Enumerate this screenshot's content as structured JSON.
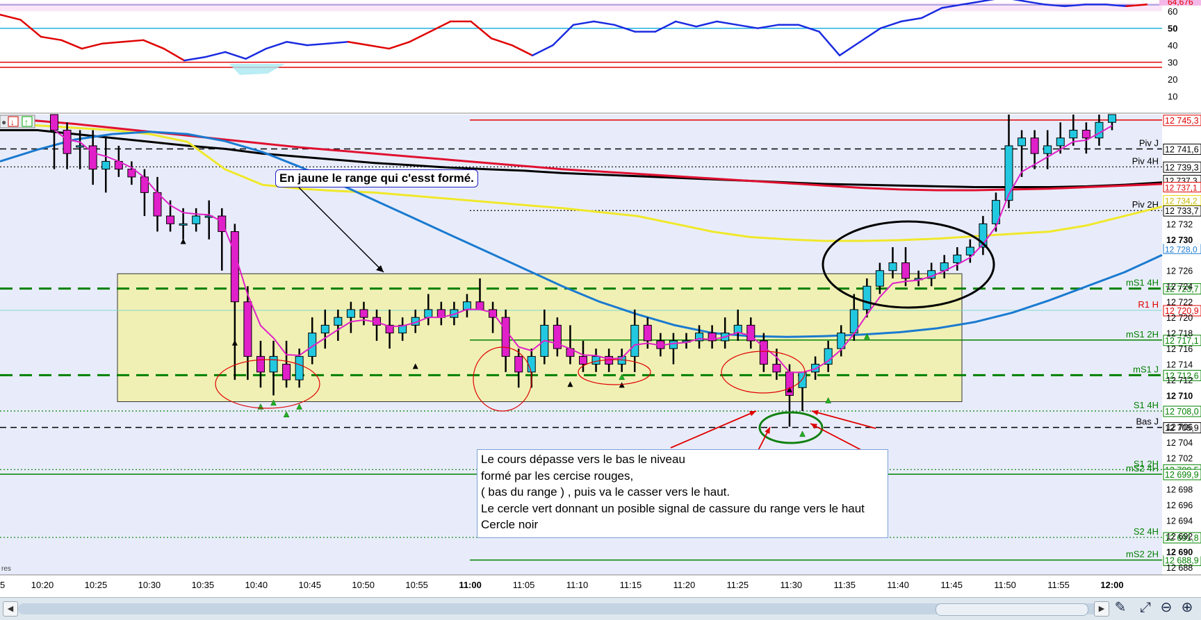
{
  "chart_data": [
    {
      "type": "line",
      "panel": "RSI indicator",
      "yticks": [
        "60",
        "50",
        "40",
        "30",
        "20",
        "10"
      ],
      "current_value_label": "64,676",
      "levels": [
        50,
        30,
        27
      ],
      "series": [
        {
          "color": "#e00000",
          "values": [
            58,
            55,
            45,
            43,
            38,
            41,
            42,
            43,
            38,
            31,
            33,
            36,
            32,
            38,
            42,
            40,
            41,
            42,
            40,
            38,
            42,
            48,
            54,
            54,
            44,
            40,
            34,
            40,
            52,
            54,
            52,
            48,
            48,
            54,
            51,
            54,
            52,
            50,
            52,
            52,
            48,
            34,
            42,
            50,
            54,
            56,
            62,
            64,
            66,
            68,
            66,
            64,
            63,
            64,
            64,
            63,
            64
          ]
        },
        {
          "color": "#1a2be0",
          "values": [
            null,
            null,
            null,
            null,
            null,
            null,
            null,
            null,
            null,
            null,
            null,
            null,
            null,
            null,
            null,
            null,
            null,
            null,
            null,
            null,
            null,
            null,
            null,
            null,
            null,
            null,
            null,
            null,
            null,
            null,
            null,
            null,
            null,
            null,
            null,
            null,
            null,
            null,
            null,
            null,
            null,
            null,
            null,
            null,
            null,
            null,
            null,
            null,
            null,
            null,
            null,
            null,
            null,
            null,
            null,
            null,
            null
          ]
        }
      ],
      "ylim": [
        0,
        65
      ]
    },
    {
      "type": "candlestick",
      "panel": "price",
      "x_ticks": [
        "10:20",
        "10:25",
        "10:30",
        "10:35",
        "10:40",
        "10:45",
        "10:50",
        "10:55",
        "11:00",
        "11:05",
        "11:10",
        "11:15",
        "11:20",
        "11:25",
        "11:30",
        "11:35",
        "11:40",
        "11:45",
        "11:50",
        "11:55",
        "12:00"
      ],
      "x_tick_first": "5",
      "x_axis_suffix": "res",
      "ylim": [
        12687,
        12746
      ],
      "price_ticks": [
        "12 732",
        "12 730",
        "12 726",
        "12 724",
        "12 722",
        "12 720",
        "12 718",
        "12 716",
        "12 714",
        "12 712",
        "12 710",
        "12 706",
        "12 704",
        "12 702",
        "12 698",
        "12 696",
        "12 694",
        "12 692",
        "12 690",
        "12 688"
      ],
      "bold_ticks": [
        "12 730",
        "12 710",
        "12 690"
      ],
      "levels": [
        {
          "label": "",
          "value_label": "12 745,3",
          "price": 12745.3,
          "color": "#e00000",
          "style": "solid"
        },
        {
          "label": "Piv J",
          "value_label": "12 741,6",
          "price": 12741.6,
          "color": "#000000",
          "style": "dash"
        },
        {
          "label": "Piv 4H",
          "value_label": "12 739,3",
          "price": 12739.3,
          "color": "#000000",
          "style": "dot"
        },
        {
          "label": "Piv 2H",
          "value_label": "12 733,7",
          "price": 12733.7,
          "color": "#000000",
          "style": "dot"
        },
        {
          "label": "mS1 4H",
          "value_label": "12 723,7",
          "price": 12723.7,
          "color": "#008000",
          "style": "bigdash"
        },
        {
          "label": "R1 H",
          "value_label": "12 720,9",
          "price": 12720.9,
          "color": "#e00000",
          "style": "thin"
        },
        {
          "label": "mS1 2H",
          "value_label": "12 717,1",
          "price": 12717.1,
          "color": "#008000",
          "style": "solid"
        },
        {
          "label": "mS1 J",
          "value_label": "12 712,6",
          "price": 12712.6,
          "color": "#008000",
          "style": "bigdash"
        },
        {
          "label": "S1 4H",
          "value_label": "12 708,0",
          "price": 12708.0,
          "color": "#008000",
          "style": "dot"
        },
        {
          "label": "Bas J",
          "value_label": "12 705,9",
          "price": 12705.9,
          "color": "#000000",
          "style": "dash"
        },
        {
          "label": "S1 2H",
          "value_label": "12 700,5",
          "price": 12700.5,
          "color": "#008000",
          "style": "dot"
        },
        {
          "label": "mS2 4H",
          "value_label": "12 699,9",
          "price": 12699.9,
          "color": "#008000",
          "style": "solid"
        },
        {
          "label": "S2 4H",
          "value_label": "12 691,8",
          "price": 12691.8,
          "color": "#008000",
          "style": "dot"
        },
        {
          "label": "mS2 2H",
          "value_label": "12 688,9",
          "price": 12688.9,
          "color": "#008000",
          "style": "solid"
        }
      ],
      "extra_axis_labels": [
        {
          "text": "12 737,3",
          "price": 12737.6,
          "color": "#000000"
        },
        {
          "text": "12 737,1",
          "price": 12736.7,
          "color": "#e00000"
        },
        {
          "text": "12 734,2",
          "price": 12735.0,
          "color": "#e8d800"
        },
        {
          "text": "12 728,0",
          "price": 12728.8,
          "color": "#1a7ad0"
        }
      ],
      "candles": [
        {
          "o": 12746,
          "h": 12746,
          "l": 12739,
          "c": 12744
        },
        {
          "o": 12744,
          "h": 12745,
          "l": 12739,
          "c": 12741
        },
        {
          "o": 12742,
          "h": 12744,
          "l": 12739,
          "c": 12742
        },
        {
          "o": 12742,
          "h": 12744,
          "l": 12737,
          "c": 12739
        },
        {
          "o": 12739,
          "h": 12743,
          "l": 12736,
          "c": 12740
        },
        {
          "o": 12740,
          "h": 12742,
          "l": 12738,
          "c": 12739
        },
        {
          "o": 12739,
          "h": 12740,
          "l": 12737,
          "c": 12738
        },
        {
          "o": 12738,
          "h": 12739,
          "l": 12733,
          "c": 12736
        },
        {
          "o": 12736,
          "h": 12738,
          "l": 12731,
          "c": 12733
        },
        {
          "o": 12733,
          "h": 12735,
          "l": 12731,
          "c": 12732
        },
        {
          "o": 12732,
          "h": 12734,
          "l": 12730,
          "c": 12732
        },
        {
          "o": 12732,
          "h": 12734,
          "l": 12731,
          "c": 12733
        },
        {
          "o": 12733,
          "h": 12735,
          "l": 12730,
          "c": 12733
        },
        {
          "o": 12733,
          "h": 12734,
          "l": 12726,
          "c": 12731
        },
        {
          "o": 12731,
          "h": 12732,
          "l": 12712,
          "c": 12722
        },
        {
          "o": 12722,
          "h": 12724,
          "l": 12712,
          "c": 12715
        },
        {
          "o": 12715,
          "h": 12717,
          "l": 12711,
          "c": 12713
        },
        {
          "o": 12713,
          "h": 12717,
          "l": 12710,
          "c": 12715
        },
        {
          "o": 12714,
          "h": 12717,
          "l": 12711,
          "c": 12712
        },
        {
          "o": 12712,
          "h": 12716,
          "l": 12711,
          "c": 12715
        },
        {
          "o": 12715,
          "h": 12720,
          "l": 12714,
          "c": 12718
        },
        {
          "o": 12718,
          "h": 12721,
          "l": 12716,
          "c": 12719
        },
        {
          "o": 12719,
          "h": 12721,
          "l": 12717,
          "c": 12720
        },
        {
          "o": 12720,
          "h": 12722,
          "l": 12718,
          "c": 12721
        },
        {
          "o": 12721,
          "h": 12722,
          "l": 12719,
          "c": 12720
        },
        {
          "o": 12720,
          "h": 12721,
          "l": 12717,
          "c": 12719
        },
        {
          "o": 12719,
          "h": 12721,
          "l": 12716,
          "c": 12718
        },
        {
          "o": 12718,
          "h": 12720,
          "l": 12717,
          "c": 12719
        },
        {
          "o": 12719,
          "h": 12721,
          "l": 12718,
          "c": 12720
        },
        {
          "o": 12720,
          "h": 12723,
          "l": 12719,
          "c": 12721
        },
        {
          "o": 12721,
          "h": 12722,
          "l": 12719,
          "c": 12720
        },
        {
          "o": 12720,
          "h": 12722,
          "l": 12719,
          "c": 12721
        },
        {
          "o": 12721,
          "h": 12723,
          "l": 12720,
          "c": 12722
        },
        {
          "o": 12722,
          "h": 12725,
          "l": 12721,
          "c": 12721
        },
        {
          "o": 12721,
          "h": 12722,
          "l": 12718,
          "c": 12720
        },
        {
          "o": 12720,
          "h": 12721,
          "l": 12713,
          "c": 12715
        },
        {
          "o": 12715,
          "h": 12716,
          "l": 12711,
          "c": 12713
        },
        {
          "o": 12713,
          "h": 12716,
          "l": 12711,
          "c": 12715
        },
        {
          "o": 12715,
          "h": 12721,
          "l": 12714,
          "c": 12719
        },
        {
          "o": 12719,
          "h": 12720,
          "l": 12715,
          "c": 12716
        },
        {
          "o": 12716,
          "h": 12719,
          "l": 12714,
          "c": 12715
        },
        {
          "o": 12715,
          "h": 12717,
          "l": 12713,
          "c": 12714
        },
        {
          "o": 12714,
          "h": 12716,
          "l": 12713,
          "c": 12715
        },
        {
          "o": 12715,
          "h": 12716,
          "l": 12713,
          "c": 12714
        },
        {
          "o": 12714,
          "h": 12716,
          "l": 12713,
          "c": 12715
        },
        {
          "o": 12715,
          "h": 12721,
          "l": 12713,
          "c": 12719
        },
        {
          "o": 12719,
          "h": 12720,
          "l": 12716,
          "c": 12717
        },
        {
          "o": 12717,
          "h": 12718,
          "l": 12715,
          "c": 12716
        },
        {
          "o": 12716,
          "h": 12718,
          "l": 12714,
          "c": 12717
        },
        {
          "o": 12717,
          "h": 12718,
          "l": 12716,
          "c": 12717
        },
        {
          "o": 12717,
          "h": 12719,
          "l": 12716,
          "c": 12718
        },
        {
          "o": 12718,
          "h": 12719,
          "l": 12716,
          "c": 12717
        },
        {
          "o": 12717,
          "h": 12720,
          "l": 12716,
          "c": 12718
        },
        {
          "o": 12718,
          "h": 12721,
          "l": 12717,
          "c": 12719
        },
        {
          "o": 12719,
          "h": 12720,
          "l": 12716,
          "c": 12717
        },
        {
          "o": 12717,
          "h": 12718,
          "l": 12713,
          "c": 12714
        },
        {
          "o": 12714,
          "h": 12716,
          "l": 12712,
          "c": 12713
        },
        {
          "o": 12713,
          "h": 12714,
          "l": 12706,
          "c": 12710
        },
        {
          "o": 12711,
          "h": 12713,
          "l": 12708,
          "c": 12713
        },
        {
          "o": 12713,
          "h": 12715,
          "l": 12712,
          "c": 12714
        },
        {
          "o": 12714,
          "h": 12717,
          "l": 12713,
          "c": 12716
        },
        {
          "o": 12716,
          "h": 12719,
          "l": 12715,
          "c": 12718
        },
        {
          "o": 12718,
          "h": 12723,
          "l": 12717,
          "c": 12721
        },
        {
          "o": 12721,
          "h": 12725,
          "l": 12720,
          "c": 12724
        },
        {
          "o": 12724,
          "h": 12727,
          "l": 12723,
          "c": 12726
        },
        {
          "o": 12726,
          "h": 12729,
          "l": 12725,
          "c": 12727
        },
        {
          "o": 12727,
          "h": 12729,
          "l": 12724,
          "c": 12725
        },
        {
          "o": 12725,
          "h": 12726,
          "l": 12724,
          "c": 12725
        },
        {
          "o": 12725,
          "h": 12727,
          "l": 12724,
          "c": 12726
        },
        {
          "o": 12726,
          "h": 12728,
          "l": 12725,
          "c": 12727
        },
        {
          "o": 12727,
          "h": 12729,
          "l": 12726,
          "c": 12728
        },
        {
          "o": 12728,
          "h": 12730,
          "l": 12727,
          "c": 12729
        },
        {
          "o": 12729,
          "h": 12733,
          "l": 12728,
          "c": 12732
        },
        {
          "o": 12732,
          "h": 12736,
          "l": 12731,
          "c": 12735
        },
        {
          "o": 12735,
          "h": 12746,
          "l": 12734,
          "c": 12742
        },
        {
          "o": 12742,
          "h": 12744,
          "l": 12738,
          "c": 12743
        },
        {
          "o": 12743,
          "h": 12744,
          "l": 12739,
          "c": 12741
        },
        {
          "o": 12741,
          "h": 12744,
          "l": 12739,
          "c": 12742
        },
        {
          "o": 12742,
          "h": 12745,
          "l": 12741,
          "c": 12743
        },
        {
          "o": 12743,
          "h": 12746,
          "l": 12742,
          "c": 12744
        },
        {
          "o": 12744,
          "h": 12745,
          "l": 12741,
          "c": 12743
        },
        {
          "o": 12743,
          "h": 12746,
          "l": 12742,
          "c": 12745
        },
        {
          "o": 12745,
          "h": 12746,
          "l": 12744,
          "c": 12746
        }
      ],
      "moving_averages": [
        {
          "color": "#000000",
          "values": [
            12744,
            12744,
            12743.5,
            12743,
            12742.5,
            12742,
            12741.6,
            12741,
            12740.6,
            12740.2,
            12739.8,
            12739.5,
            12739.2,
            12739,
            12738.8,
            12738.5,
            12738.3,
            12738.1,
            12737.9,
            12737.7,
            12737.5,
            12737.3,
            12737.1,
            12737,
            12736.9,
            12736.8,
            12736.7,
            12736.7,
            12736.7,
            12736.8,
            12737,
            12737.3
          ]
        },
        {
          "color": "#e01030",
          "values": [
            12745.5,
            12745.2,
            12744.8,
            12744.3,
            12743.8,
            12743.3,
            12742.8,
            12742.3,
            12741.8,
            12741.4,
            12741,
            12740.6,
            12740.2,
            12739.8,
            12739.4,
            12739,
            12738.7,
            12738.4,
            12738.1,
            12737.8,
            12737.5,
            12737.2,
            12736.9,
            12736.6,
            12736.4,
            12736.3,
            12736.3,
            12736.4,
            12736.5,
            12736.7,
            12736.9,
            12737.1
          ]
        },
        {
          "color": "#f0e82a",
          "values": [
            12744.8,
            12744.6,
            12744.3,
            12744,
            12743.5,
            12742.5,
            12739,
            12737,
            12736.5,
            12736.2,
            12736,
            12735.6,
            12735.2,
            12734.8,
            12734.4,
            12734,
            12733.5,
            12733,
            12732,
            12731,
            12730.3,
            12730,
            12729.8,
            12729.8,
            12729.9,
            12730.1,
            12730.4,
            12730.7,
            12731,
            12731.8,
            12733,
            12734.2
          ]
        },
        {
          "color": "#1a7ad0",
          "values": [
            12740,
            12741.5,
            12742.8,
            12743.5,
            12743.8,
            12743.5,
            12742.6,
            12741.2,
            12739.3,
            12737.2,
            12735,
            12732.8,
            12730.6,
            12728.4,
            12726.2,
            12724,
            12722,
            12720.4,
            12719,
            12718,
            12717.6,
            12717.5,
            12717.6,
            12717.8,
            12718.1,
            12718.6,
            12719.4,
            12720.6,
            12722.2,
            12724,
            12725.8,
            12728
          ]
        }
      ],
      "annotations": [
        "En jaune le range qui c'esst formé.",
        "Le cours dépasse vers le bas le niveau",
        "formé par les cercise rouges,",
        "( bas du range ) , puis va le casser vers le haut.",
        "Le cercle vert donnant un posible signal de cassure du range vers le haut",
        "Cercle noir"
      ]
    }
  ],
  "colors": {
    "bull_candle": "#22c8e0",
    "bear_candle": "#e020c8",
    "range_fill": "#f0f0b4",
    "price_bg": "#e8ecfa",
    "rsi_oversold_fill": "#a8e8f0",
    "rsi_overbought_fill": "#f4b8e8"
  },
  "icons": [
    "sell-arrow-icon",
    "buy-arrow-icon",
    "scroll-left-icon",
    "scroll-right-icon",
    "pencil-icon",
    "zoom-fit-icon",
    "zoom-out-icon",
    "zoom-in-icon"
  ]
}
